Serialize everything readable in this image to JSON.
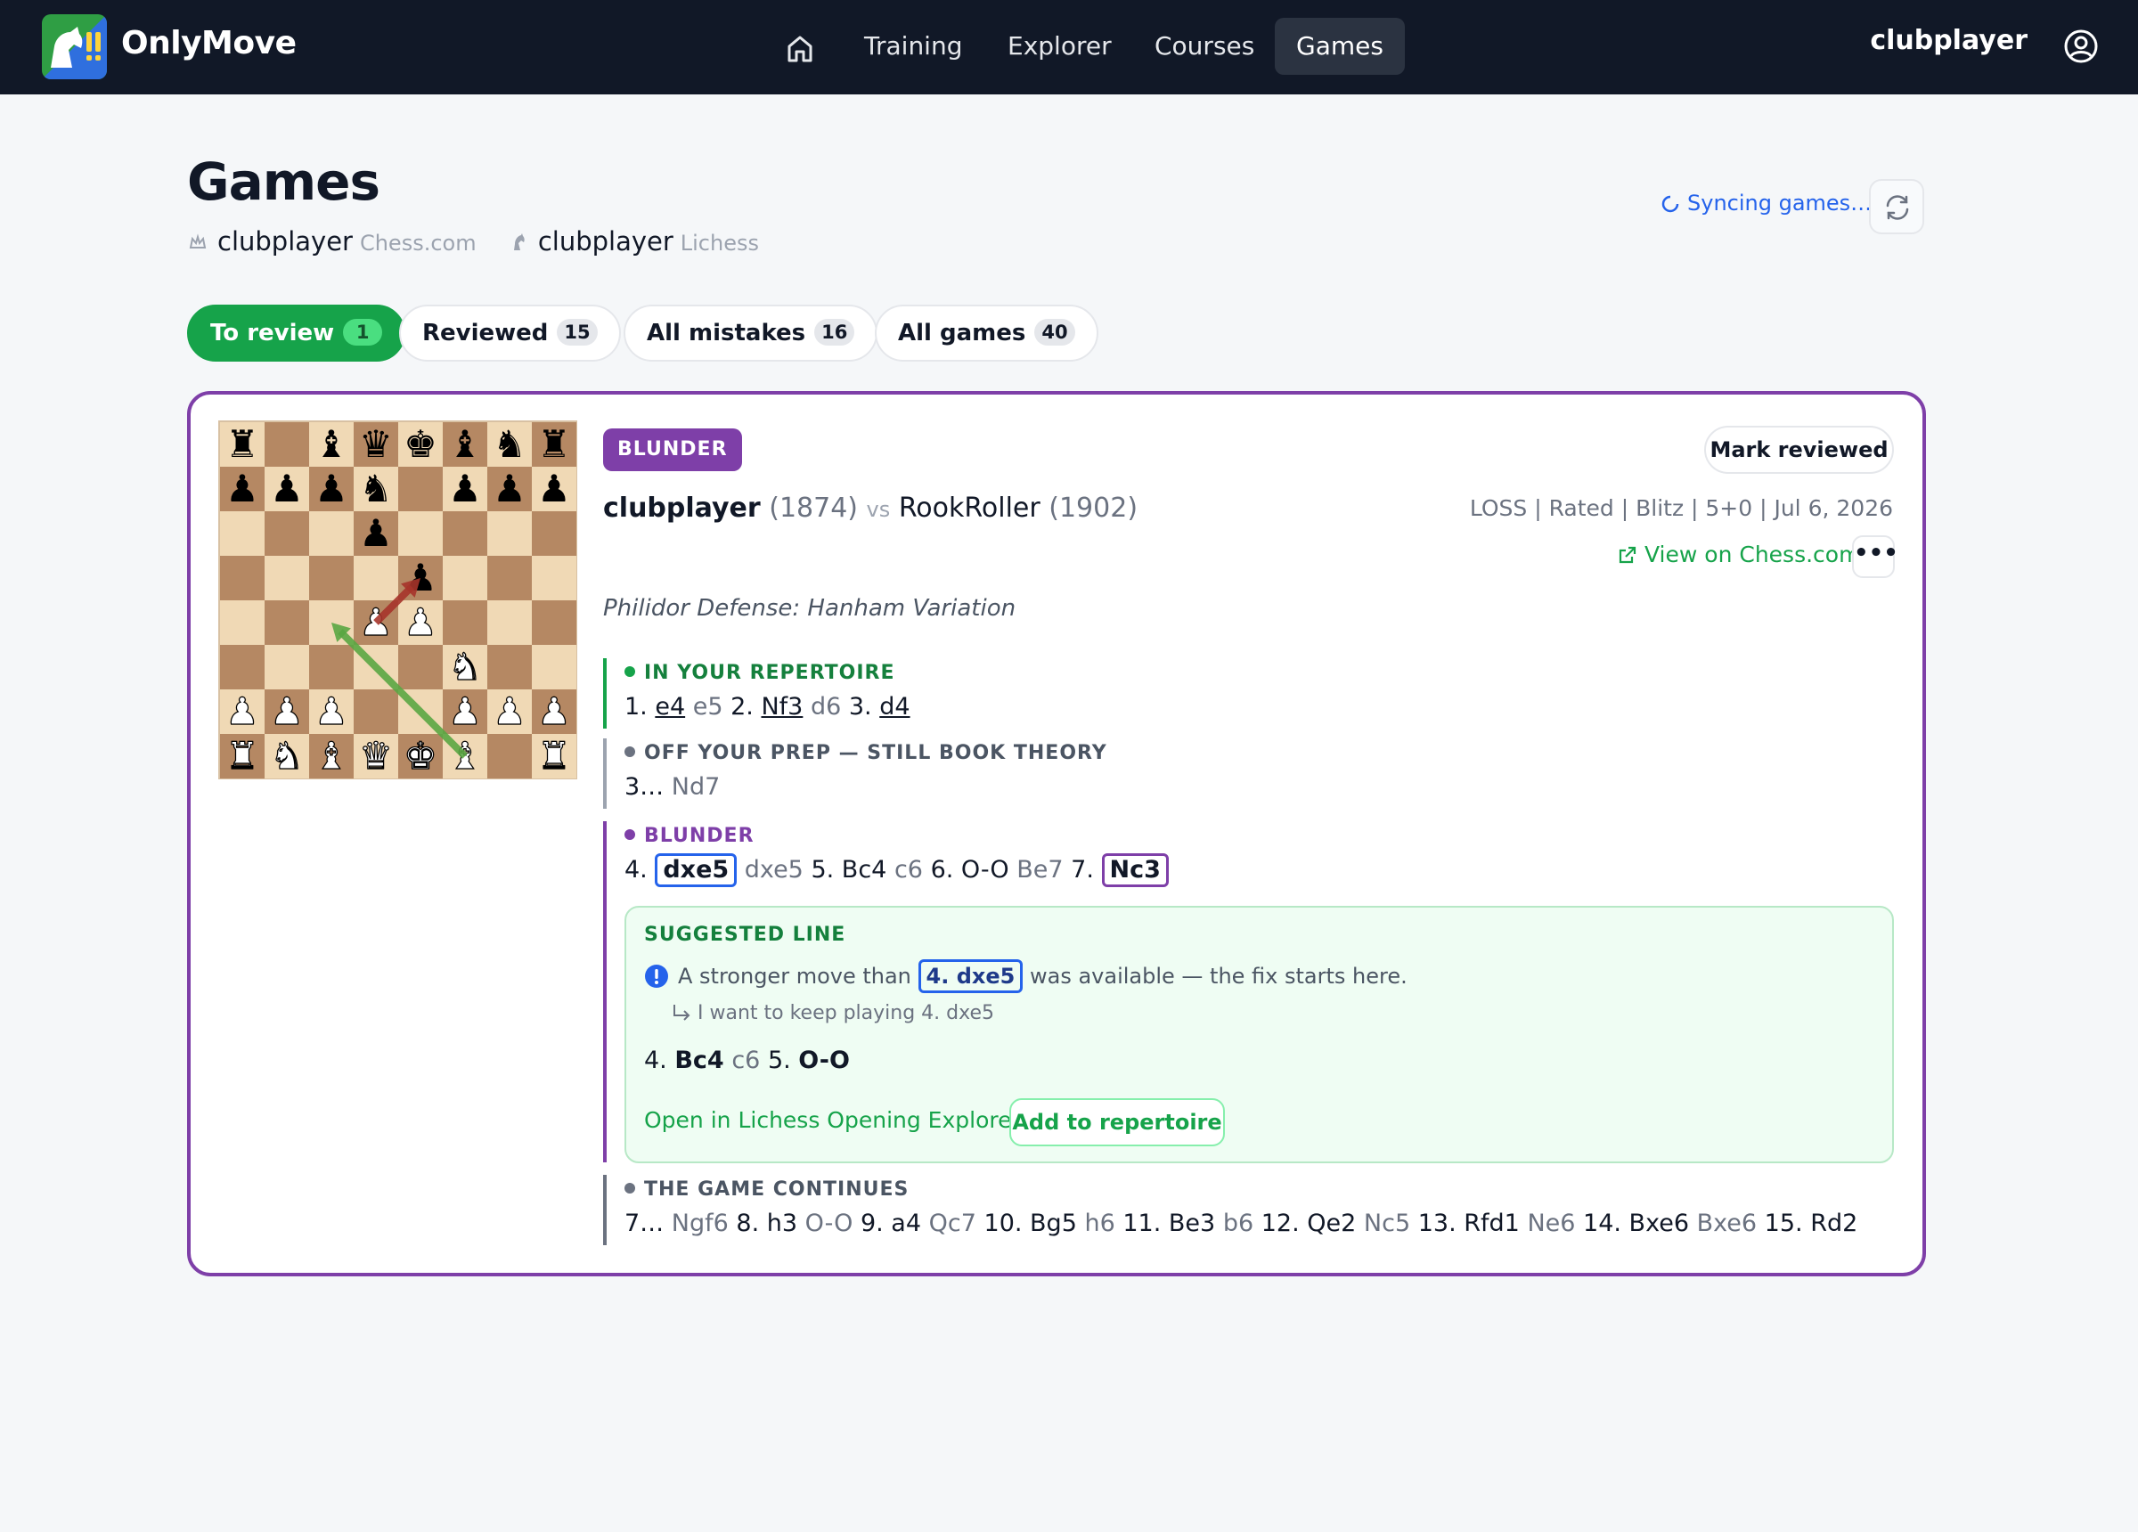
{
  "app": {
    "brand": "OnlyMove",
    "nav": [
      "Training",
      "Explorer",
      "Courses",
      "Games"
    ],
    "active_nav": "Games",
    "username": "clubplayer"
  },
  "page": {
    "title": "Games",
    "accounts": [
      {
        "name": "clubplayer",
        "site": "Chess.com"
      },
      {
        "name": "clubplayer",
        "site": "Lichess"
      }
    ],
    "sync_status": "Syncing games…"
  },
  "tabs": [
    {
      "label": "To review",
      "count": "1",
      "active": true
    },
    {
      "label": "Reviewed",
      "count": "15",
      "active": false
    },
    {
      "label": "All mistakes",
      "count": "16",
      "active": false
    },
    {
      "label": "All games",
      "count": "40",
      "active": false
    }
  ],
  "game": {
    "badge": "BLUNDER",
    "mark_reviewed": "Mark reviewed",
    "white": "clubplayer",
    "white_rating": "(1874)",
    "vs": "vs",
    "black": "RookRoller",
    "black_rating": "(1902)",
    "meta": "LOSS | Rated | Blitz | 5+0 | Jul 6, 2026",
    "view_link": "View on Chess.com",
    "more": "•••",
    "opening": "Philidor Defense: Hanham Variation",
    "board": {
      "ranks": [
        "r . b q k b n r",
        "p p p n . p p p",
        ". . . p . . . .",
        ". . . . p . . .",
        ". . . P P . . .",
        ". . . . . N . .",
        "P P P . . P P P",
        "R N B Q K B . R"
      ],
      "arrows": [
        {
          "from": "f1",
          "to": "c4",
          "color": "#5aa642"
        },
        {
          "from": "d4",
          "to": "e5",
          "color": "#a6342a"
        }
      ]
    },
    "sections": {
      "repertoire": {
        "heading": "IN YOUR REPERTOIRE",
        "moves": [
          {
            "t": "1. ",
            "s": "n"
          },
          {
            "t": "e4",
            "s": "u"
          },
          {
            "t": " e5",
            "s": "o"
          },
          {
            "t": " 2. ",
            "s": "n"
          },
          {
            "t": "Nf3",
            "s": "u"
          },
          {
            "t": " d6",
            "s": "o"
          },
          {
            "t": " 3. ",
            "s": "n"
          },
          {
            "t": "d4",
            "s": "u"
          }
        ]
      },
      "off_prep": {
        "heading": "OFF YOUR PREP — STILL BOOK THEORY",
        "moves": [
          {
            "t": "3… ",
            "s": "n"
          },
          {
            "t": "Nd7",
            "s": "o"
          }
        ]
      },
      "blunder": {
        "heading": "BLUNDER",
        "moves": [
          {
            "t": "4. ",
            "s": "n"
          },
          {
            "t": "dxe5",
            "s": "box-blue"
          },
          {
            "t": " dxe5",
            "s": "o"
          },
          {
            "t": " 5. Bc4",
            "s": "n"
          },
          {
            "t": " c6",
            "s": "o"
          },
          {
            "t": " 6. O-O",
            "s": "n"
          },
          {
            "t": " Be7",
            "s": "o"
          },
          {
            "t": " 7. ",
            "s": "n"
          },
          {
            "t": "Nc3",
            "s": "box-purple"
          }
        ]
      },
      "suggested": {
        "heading": "SUGGESTED LINE",
        "msg_before": "A stronger move than",
        "msg_move": "4. dxe5",
        "msg_after": "was available — the fix starts here.",
        "keep": "I want to keep playing 4. dxe5",
        "line": [
          {
            "t": "4. ",
            "s": "n"
          },
          {
            "t": "Bc4",
            "s": "b"
          },
          {
            "t": " c6",
            "s": "o"
          },
          {
            "t": " 5. ",
            "s": "n"
          },
          {
            "t": "O-O",
            "s": "b"
          }
        ],
        "open_explorer": "Open in Lichess Opening Explorer",
        "add_repertoire": "Add to repertoire"
      },
      "continues": {
        "heading": "THE GAME CONTINUES",
        "moves": [
          {
            "t": "7… ",
            "s": "n"
          },
          {
            "t": "Ngf6",
            "s": "o"
          },
          {
            "t": " 8. h3",
            "s": "n"
          },
          {
            "t": " O-O",
            "s": "o"
          },
          {
            "t": " 9. a4",
            "s": "n"
          },
          {
            "t": " Qc7",
            "s": "o"
          },
          {
            "t": " 10. Bg5",
            "s": "n"
          },
          {
            "t": " h6",
            "s": "o"
          },
          {
            "t": " 11. Be3",
            "s": "n"
          },
          {
            "t": " b6",
            "s": "o"
          },
          {
            "t": " 12. Qe2",
            "s": "n"
          },
          {
            "t": " Nc5",
            "s": "o"
          },
          {
            "t": " 13. Rfd1",
            "s": "n"
          },
          {
            "t": " Ne6",
            "s": "o"
          },
          {
            "t": " 14. Bxe6",
            "s": "n"
          },
          {
            "t": " Bxe6",
            "s": "o"
          },
          {
            "t": " 15. Rd2",
            "s": "n"
          }
        ]
      }
    }
  },
  "colors": {
    "accent_purple": "#7e3fa8",
    "accent_green": "#16a34a",
    "link_blue": "#2563eb",
    "header_bg": "#111827",
    "board_light": "#f0d9b5",
    "board_dark": "#b58863"
  },
  "icons": [
    "logo-icon",
    "home-icon",
    "user-circle-icon",
    "crown-icon",
    "knight-icon",
    "spinner-icon",
    "refresh-icon",
    "external-link-icon",
    "info-icon",
    "return-arrow-icon"
  ]
}
